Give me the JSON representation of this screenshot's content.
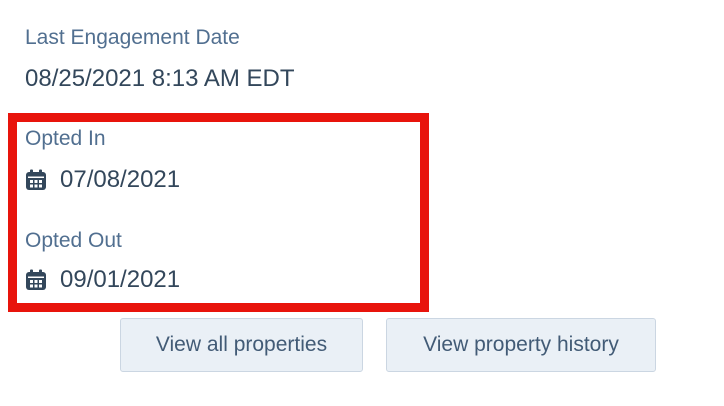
{
  "last_engagement": {
    "label": "Last Engagement Date",
    "value": "08/25/2021 8:13 AM EDT"
  },
  "opted_in": {
    "label": "Opted In",
    "icon": "calendar-icon",
    "value": "07/08/2021"
  },
  "opted_out": {
    "label": "Opted Out",
    "icon": "calendar-icon",
    "value": "09/01/2021"
  },
  "buttons": {
    "view_all_properties": "View all properties",
    "view_property_history": "View property history"
  },
  "colors": {
    "highlight_border": "#e8140c",
    "label_text": "#516f90",
    "value_text": "#33475b",
    "button_bg": "#eaf0f6",
    "button_border": "#cbd6e2"
  }
}
